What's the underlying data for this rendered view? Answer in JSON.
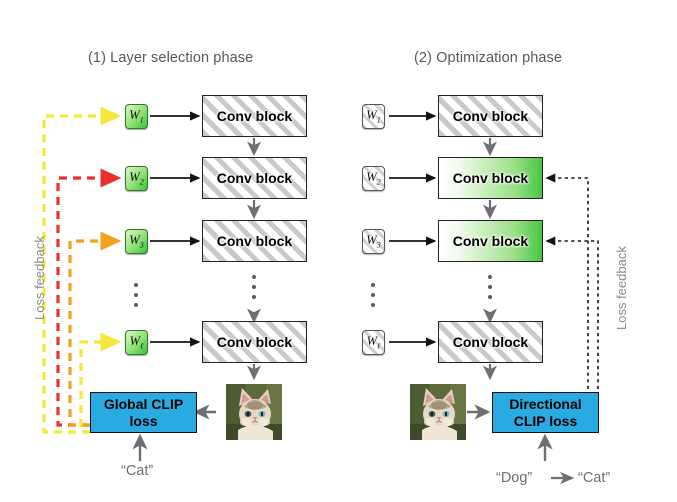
{
  "panels": [
    {
      "title": "(1) Layer selection phase",
      "feedback_label": "Loss feedback",
      "loss_box": {
        "line1": "Global CLIP",
        "line2": "loss"
      },
      "prompt": "“Cat”",
      "weights": [
        {
          "base": "W",
          "sub": "1"
        },
        {
          "base": "W",
          "sub": "2"
        },
        {
          "base": "W",
          "sub": "3"
        },
        {
          "base": "W",
          "sub": "ℓ"
        }
      ],
      "blocks": [
        {
          "label": "Conv block",
          "style": "hatched"
        },
        {
          "label": "Conv block",
          "style": "hatched"
        },
        {
          "label": "Conv block",
          "style": "hatched"
        },
        {
          "label": "Conv block",
          "style": "hatched"
        }
      ]
    },
    {
      "title": "(2) Optimization phase",
      "feedback_label": "Loss feedback",
      "loss_box": {
        "line1": "Directional",
        "line2": "CLIP loss"
      },
      "prompt_source": "“Dog”",
      "prompt_target": "“Cat”",
      "weights": [
        {
          "base": "W",
          "sub": "1"
        },
        {
          "base": "W",
          "sub": "2"
        },
        {
          "base": "W",
          "sub": "3"
        },
        {
          "base": "W",
          "sub": "ℓ"
        }
      ],
      "blocks": [
        {
          "label": "Conv block",
          "style": "hatched"
        },
        {
          "label": "Conv block",
          "style": "green"
        },
        {
          "label": "Conv block",
          "style": "green"
        },
        {
          "label": "Conv block",
          "style": "hatched"
        }
      ]
    }
  ],
  "colors": {
    "feedback_yellow": "#F5E73C",
    "feedback_red": "#E8312B",
    "feedback_orange": "#F6A020",
    "loss_box_blue": "#29ABE2",
    "block_green": "#46C842",
    "arrow_gray": "#6E6E76",
    "arrow_black": "#141414",
    "title_gray": "#58585A",
    "caption_gray": "#8A8A8A"
  },
  "icons": {
    "cat_photo": "cat-photo",
    "vertical_ellipsis": "vertical-ellipsis"
  }
}
